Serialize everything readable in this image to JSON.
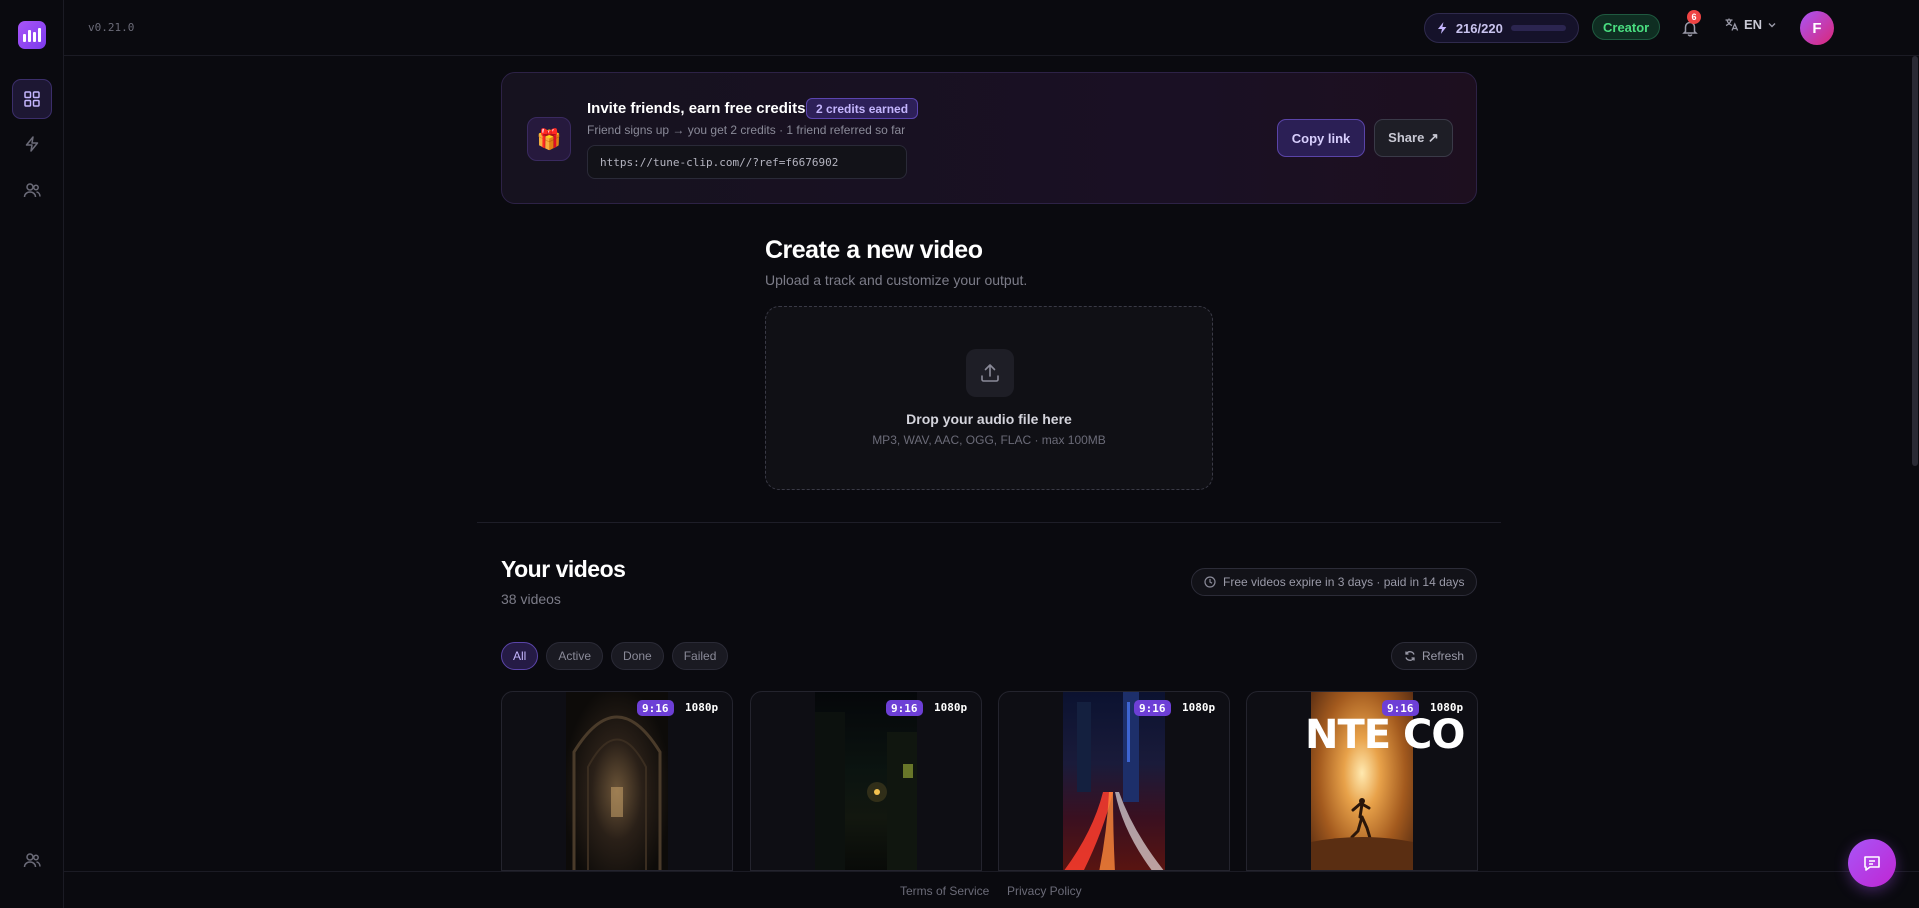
{
  "app": {
    "version": "v0.21.0"
  },
  "header": {
    "credits": "216/220",
    "credits_fraction": 0.98,
    "plan": "Creator",
    "notification_count": "6",
    "language": "EN",
    "avatar_initial": "F"
  },
  "sidebar": {
    "items": [
      {
        "name": "dashboard",
        "icon": "grid-icon",
        "active": true
      },
      {
        "name": "activity",
        "icon": "bolt-icon",
        "active": false
      },
      {
        "name": "team",
        "icon": "users-icon",
        "active": false
      }
    ],
    "bottom_icon": "users-icon"
  },
  "invite": {
    "title": "Invite friends, earn free credits",
    "earned": "2 credits earned",
    "subtitle": "Friend signs up → you get 2 credits · 1 friend referred so far",
    "link": "https://tune-clip.com//?ref=f6676902",
    "copy_label": "Copy link",
    "share_label": "Share ↗"
  },
  "create": {
    "title": "Create a new video",
    "subtitle": "Upload a track and customize your output.",
    "drop_title": "Drop your audio file here",
    "drop_sub": "MP3, WAV, AAC, OGG, FLAC · max 100MB"
  },
  "videos": {
    "title": "Your videos",
    "count": "38 videos",
    "expiry_note": "Free videos expire in 3 days · paid in 14 days",
    "filters": [
      "All",
      "Active",
      "Done",
      "Failed"
    ],
    "refresh_label": "Refresh",
    "cards": [
      {
        "ratio": "9:16",
        "resolution": "1080p"
      },
      {
        "ratio": "9:16",
        "resolution": "1080p"
      },
      {
        "ratio": "9:16",
        "resolution": "1080p"
      },
      {
        "ratio": "9:16",
        "resolution": "1080p",
        "overlay_text": "NTE CO"
      }
    ]
  },
  "footer": {
    "terms": "Terms of Service",
    "privacy": "Privacy Policy"
  },
  "colors": {
    "accent": "#8b5cf6",
    "background": "#0a0a0f",
    "plan_badge": "#4ade80",
    "notification": "#ef4444"
  }
}
